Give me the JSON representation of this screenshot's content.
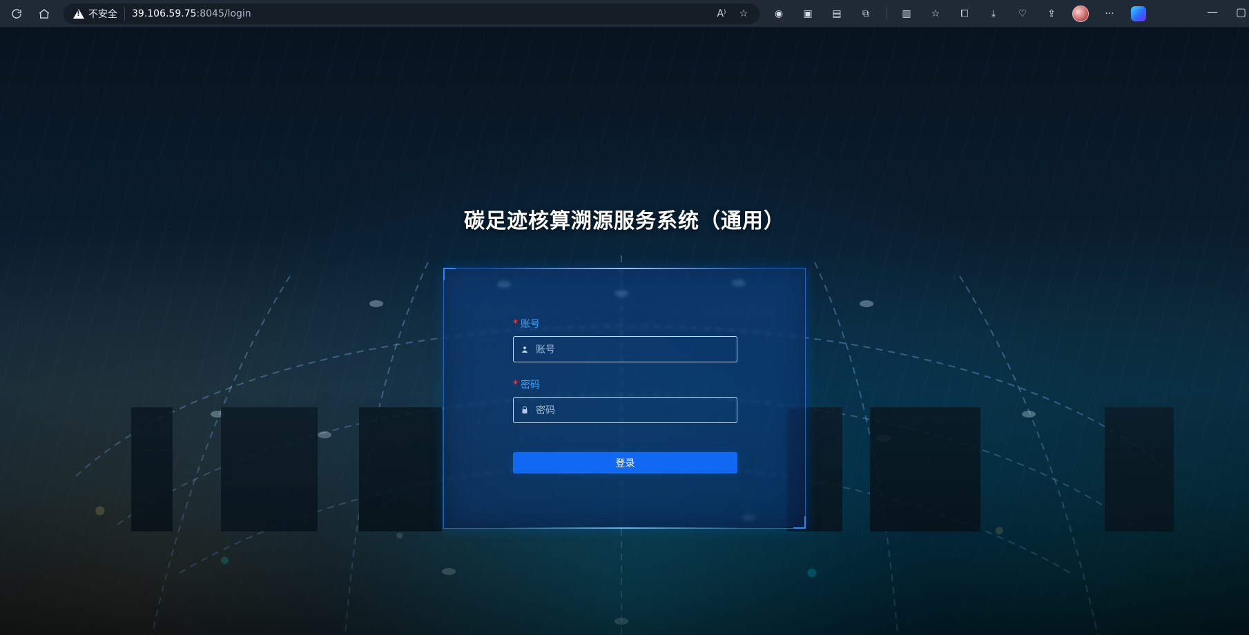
{
  "browser": {
    "security_text": "不安全",
    "url_host": "39.106.59.75",
    "url_rest": ":8045/login",
    "icons": {
      "refresh": "refresh-icon",
      "home": "home-icon",
      "read_aloud": "read-aloud-icon",
      "favorite": "favorite-star-icon",
      "extensions": "extensions-icon",
      "split_screen": "split-screen-icon",
      "favorites": "favorites-icon",
      "collections": "collections-icon",
      "downloads": "downloads-icon",
      "browser_essentials": "heart-pulse-icon",
      "share": "share-icon",
      "more": "more-icon",
      "copilot": "copilot-icon",
      "minimize": "minimize-icon",
      "restore": "restore-icon"
    },
    "more_label": "···",
    "minimize_label": "—"
  },
  "page": {
    "title": "碳足迹核算溯源服务系统（通用）"
  },
  "form": {
    "account_label": "账号",
    "account_placeholder": "账号",
    "password_label": "密码",
    "password_placeholder": "密码",
    "login_label": "登录",
    "required_mark": "*"
  },
  "colors": {
    "accent": "#1168f2",
    "label": "#3da2ff",
    "required": "#ff4b4b"
  }
}
